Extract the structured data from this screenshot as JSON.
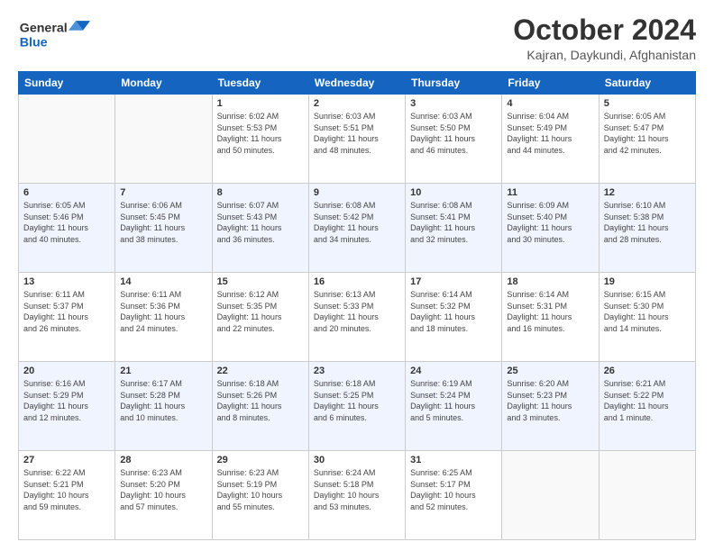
{
  "header": {
    "logo_general": "General",
    "logo_blue": "Blue",
    "month_title": "October 2024",
    "location": "Kajran, Daykundi, Afghanistan"
  },
  "weekdays": [
    "Sunday",
    "Monday",
    "Tuesday",
    "Wednesday",
    "Thursday",
    "Friday",
    "Saturday"
  ],
  "weeks": [
    [
      {
        "day": "",
        "info": ""
      },
      {
        "day": "",
        "info": ""
      },
      {
        "day": "1",
        "info": "Sunrise: 6:02 AM\nSunset: 5:53 PM\nDaylight: 11 hours\nand 50 minutes."
      },
      {
        "day": "2",
        "info": "Sunrise: 6:03 AM\nSunset: 5:51 PM\nDaylight: 11 hours\nand 48 minutes."
      },
      {
        "day": "3",
        "info": "Sunrise: 6:03 AM\nSunset: 5:50 PM\nDaylight: 11 hours\nand 46 minutes."
      },
      {
        "day": "4",
        "info": "Sunrise: 6:04 AM\nSunset: 5:49 PM\nDaylight: 11 hours\nand 44 minutes."
      },
      {
        "day": "5",
        "info": "Sunrise: 6:05 AM\nSunset: 5:47 PM\nDaylight: 11 hours\nand 42 minutes."
      }
    ],
    [
      {
        "day": "6",
        "info": "Sunrise: 6:05 AM\nSunset: 5:46 PM\nDaylight: 11 hours\nand 40 minutes."
      },
      {
        "day": "7",
        "info": "Sunrise: 6:06 AM\nSunset: 5:45 PM\nDaylight: 11 hours\nand 38 minutes."
      },
      {
        "day": "8",
        "info": "Sunrise: 6:07 AM\nSunset: 5:43 PM\nDaylight: 11 hours\nand 36 minutes."
      },
      {
        "day": "9",
        "info": "Sunrise: 6:08 AM\nSunset: 5:42 PM\nDaylight: 11 hours\nand 34 minutes."
      },
      {
        "day": "10",
        "info": "Sunrise: 6:08 AM\nSunset: 5:41 PM\nDaylight: 11 hours\nand 32 minutes."
      },
      {
        "day": "11",
        "info": "Sunrise: 6:09 AM\nSunset: 5:40 PM\nDaylight: 11 hours\nand 30 minutes."
      },
      {
        "day": "12",
        "info": "Sunrise: 6:10 AM\nSunset: 5:38 PM\nDaylight: 11 hours\nand 28 minutes."
      }
    ],
    [
      {
        "day": "13",
        "info": "Sunrise: 6:11 AM\nSunset: 5:37 PM\nDaylight: 11 hours\nand 26 minutes."
      },
      {
        "day": "14",
        "info": "Sunrise: 6:11 AM\nSunset: 5:36 PM\nDaylight: 11 hours\nand 24 minutes."
      },
      {
        "day": "15",
        "info": "Sunrise: 6:12 AM\nSunset: 5:35 PM\nDaylight: 11 hours\nand 22 minutes."
      },
      {
        "day": "16",
        "info": "Sunrise: 6:13 AM\nSunset: 5:33 PM\nDaylight: 11 hours\nand 20 minutes."
      },
      {
        "day": "17",
        "info": "Sunrise: 6:14 AM\nSunset: 5:32 PM\nDaylight: 11 hours\nand 18 minutes."
      },
      {
        "day": "18",
        "info": "Sunrise: 6:14 AM\nSunset: 5:31 PM\nDaylight: 11 hours\nand 16 minutes."
      },
      {
        "day": "19",
        "info": "Sunrise: 6:15 AM\nSunset: 5:30 PM\nDaylight: 11 hours\nand 14 minutes."
      }
    ],
    [
      {
        "day": "20",
        "info": "Sunrise: 6:16 AM\nSunset: 5:29 PM\nDaylight: 11 hours\nand 12 minutes."
      },
      {
        "day": "21",
        "info": "Sunrise: 6:17 AM\nSunset: 5:28 PM\nDaylight: 11 hours\nand 10 minutes."
      },
      {
        "day": "22",
        "info": "Sunrise: 6:18 AM\nSunset: 5:26 PM\nDaylight: 11 hours\nand 8 minutes."
      },
      {
        "day": "23",
        "info": "Sunrise: 6:18 AM\nSunset: 5:25 PM\nDaylight: 11 hours\nand 6 minutes."
      },
      {
        "day": "24",
        "info": "Sunrise: 6:19 AM\nSunset: 5:24 PM\nDaylight: 11 hours\nand 5 minutes."
      },
      {
        "day": "25",
        "info": "Sunrise: 6:20 AM\nSunset: 5:23 PM\nDaylight: 11 hours\nand 3 minutes."
      },
      {
        "day": "26",
        "info": "Sunrise: 6:21 AM\nSunset: 5:22 PM\nDaylight: 11 hours\nand 1 minute."
      }
    ],
    [
      {
        "day": "27",
        "info": "Sunrise: 6:22 AM\nSunset: 5:21 PM\nDaylight: 10 hours\nand 59 minutes."
      },
      {
        "day": "28",
        "info": "Sunrise: 6:23 AM\nSunset: 5:20 PM\nDaylight: 10 hours\nand 57 minutes."
      },
      {
        "day": "29",
        "info": "Sunrise: 6:23 AM\nSunset: 5:19 PM\nDaylight: 10 hours\nand 55 minutes."
      },
      {
        "day": "30",
        "info": "Sunrise: 6:24 AM\nSunset: 5:18 PM\nDaylight: 10 hours\nand 53 minutes."
      },
      {
        "day": "31",
        "info": "Sunrise: 6:25 AM\nSunset: 5:17 PM\nDaylight: 10 hours\nand 52 minutes."
      },
      {
        "day": "",
        "info": ""
      },
      {
        "day": "",
        "info": ""
      }
    ]
  ]
}
